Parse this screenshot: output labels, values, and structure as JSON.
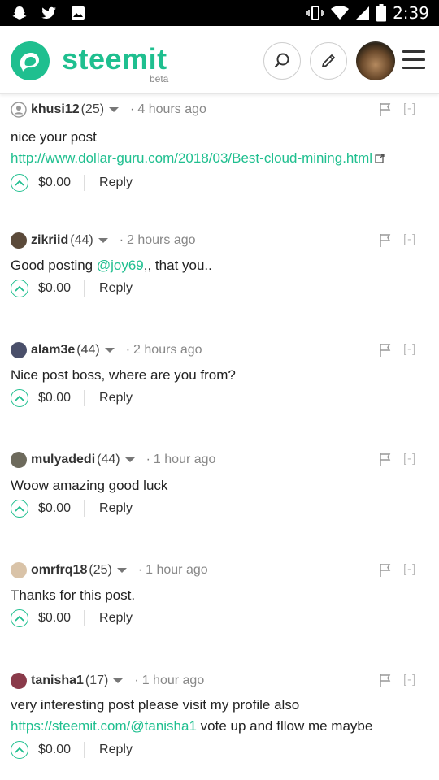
{
  "status_bar": {
    "left_icons": [
      "snapchat-icon",
      "twitter-icon",
      "image-icon"
    ],
    "right_icons": [
      "vibrate-icon",
      "wifi-icon",
      "signal-icon",
      "battery-icon"
    ],
    "time": "2:39"
  },
  "header": {
    "brand": "steemit",
    "beta": "beta",
    "icons": [
      "search-icon",
      "pencil-icon",
      "user-avatar",
      "hamburger-menu-icon"
    ],
    "accent_color": "#1fbf8f"
  },
  "comments": [
    {
      "author": "khusi12",
      "rep": "(25)",
      "time": "4 hours ago",
      "avatar_color": "#9aa3ad",
      "text": "nice your post",
      "link": "http://www.dollar-guru.com/2018/03/Best-cloud-mining.html",
      "payout": "$0.00",
      "reply": "Reply",
      "collapse": "[-]"
    },
    {
      "author": "zikriid",
      "rep": "(44)",
      "time": "2 hours ago",
      "avatar_color": "#5b4a3a",
      "text_pre": "Good posting ",
      "mention": "@joy69",
      "text_post": ",, that you..",
      "payout": "$0.00",
      "reply": "Reply",
      "collapse": "[-]"
    },
    {
      "author": "alam3e",
      "rep": "(44)",
      "time": "2 hours ago",
      "avatar_color": "#4a4f6a",
      "text": "Nice post boss, where are you from?",
      "payout": "$0.00",
      "reply": "Reply",
      "collapse": "[-]"
    },
    {
      "author": "mulyadedi",
      "rep": "(44)",
      "time": "1 hour ago",
      "avatar_color": "#6d6a5c",
      "text": "Woow amazing good luck",
      "payout": "$0.00",
      "reply": "Reply",
      "collapse": "[-]"
    },
    {
      "author": "omrfrq18",
      "rep": "(25)",
      "time": "1 hour ago",
      "avatar_color": "#d9c3a8",
      "text": "Thanks for this post.",
      "payout": "$0.00",
      "reply": "Reply",
      "collapse": "[-]"
    },
    {
      "author": "tanisha1",
      "rep": "(17)",
      "time": "1 hour ago",
      "avatar_color": "#8a3a4a",
      "text": "very interesting post please visit my profile also",
      "link2": "https://steemit.com/@tanisha1",
      "text2_post": " vote up and fllow me maybe",
      "payout": "$0.00",
      "reply": "Reply",
      "collapse": "[-]"
    }
  ]
}
